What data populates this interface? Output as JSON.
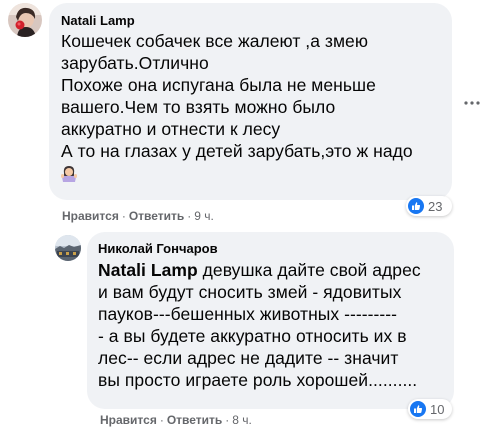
{
  "comments": [
    {
      "author": "Natali Lamp",
      "text_lines": [
        "Кошечек собачек все жалеют ,а змею",
        "зарубать.Отлично",
        "Похоже она испугана была не меньше",
        "вашего.Чем то взять можно было",
        "аккуратно и отнести к лесу",
        "А то на глазах у детей зарубать,это ж надо"
      ],
      "emoji": "woman-shrugging-emoji",
      "actions": {
        "like": "Нравится",
        "reply": "Ответить",
        "time": "9 ч."
      },
      "reaction_count": "23",
      "reaction_icon": "like-icon"
    },
    {
      "author": "Николай Гончаров",
      "mention": "Natali Lamp",
      "text_first_rest": " девушка дайте свой адрес",
      "text_lines": [
        "и вам будут сносить змей - ядовитых",
        "пауков---бешенных животных ---------",
        "- а вы будете аккуратно относить их в",
        "лес-- если адрес не дадите -- значит",
        "вы просто играете роль хорошей.........."
      ],
      "actions": {
        "like": "Нравится",
        "reply": "Ответить",
        "time": "8 ч."
      },
      "reaction_count": "10",
      "reaction_icon": "like-icon"
    }
  ],
  "separator": "·",
  "colors": {
    "bubble": "#f0f2f5",
    "meta_text": "#65676b",
    "like_blue": "#1877f2"
  }
}
